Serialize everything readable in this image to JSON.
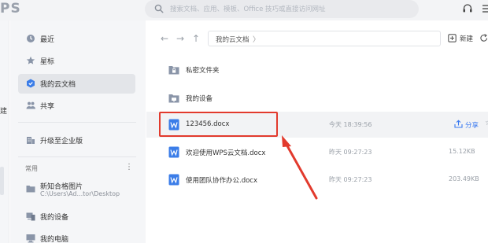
{
  "app": {
    "logo_text": "PS"
  },
  "search": {
    "placeholder": "搜索文档、应用、模板、Office 技巧或直接访问网址"
  },
  "edge": {
    "char": "建"
  },
  "sidebar": {
    "items": [
      {
        "label": "最近",
        "icon": "clock-icon"
      },
      {
        "label": "星标",
        "icon": "star-icon"
      },
      {
        "label": "我的云文档",
        "icon": "cloud-doc-icon",
        "active": true
      },
      {
        "label": "共享",
        "icon": "people-icon"
      },
      {
        "label": "升级至企业版",
        "icon": "enterprise-icon"
      }
    ],
    "section_title": "常用",
    "section_more": "⋮",
    "recent": [
      {
        "label": "新知合格图片",
        "sub": "C:\\Users\\Ad...tor\\Desktop"
      },
      {
        "label": "我的设备"
      },
      {
        "label": "我的电脑"
      }
    ]
  },
  "main": {
    "nav": {
      "back": "←",
      "forward": "→",
      "up": "↑"
    },
    "breadcrumb": "我的云文档",
    "breadcrumb_chevron": "〉",
    "new_label": "新建",
    "files": [
      {
        "name": "私密文件夹",
        "type": "lock-folder",
        "time": "",
        "size": ""
      },
      {
        "name": "我的设备",
        "type": "device-folder",
        "time": "",
        "size": ""
      },
      {
        "name": "123456.docx",
        "type": "doc",
        "time": "今天 18:39:56",
        "size": "",
        "hover": true
      },
      {
        "name": "欢迎使用WPS云文档.docx",
        "type": "doc",
        "time": "昨天 09:27:23",
        "size": "15.12KB"
      },
      {
        "name": "使用团队协作办公.docx",
        "type": "doc",
        "time": "昨天 09:27:23",
        "size": "203.49KB"
      }
    ],
    "share_label": "分享",
    "star_glyph": "☆"
  },
  "colors": {
    "accent": "#3a7af0",
    "doc_icon": "#3b7de8",
    "folder": "#8a95a8",
    "annotation": "#e23a2d"
  }
}
